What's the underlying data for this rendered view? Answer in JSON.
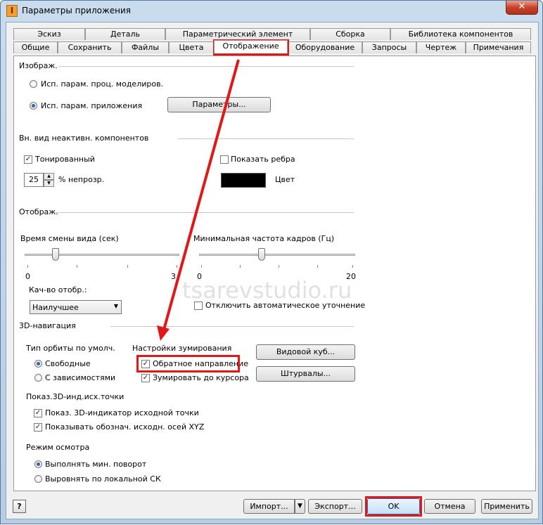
{
  "window": {
    "title": "Параметры приложения",
    "app_icon": "I",
    "close_glyph": "✕"
  },
  "tabs_row1": [
    "Эскиз",
    "Деталь",
    "Параметрический элемент",
    "Сборка",
    "Библиотека компонентов"
  ],
  "tabs_row2": [
    "Общие",
    "Сохранить",
    "Файлы",
    "Цвета",
    "Отображение",
    "Оборудование",
    "Запросы",
    "Чертеж",
    "Примечания"
  ],
  "section_image": {
    "title": "Изображ.",
    "radio_model": "Исп. парам. проц. моделиров.",
    "radio_app": "Исп. парам. приложения",
    "params_button": "Параметры..."
  },
  "section_inactive": {
    "title": "Вн. вид неактивн. компонентов",
    "shaded": "Тонированный",
    "show_edges": "Показать ребра",
    "opacity_value": "25",
    "opacity_label": "% непрозр.",
    "color_label": "Цвет",
    "color_swatch": "#000000"
  },
  "section_display": {
    "title": "Отображ.",
    "view_time_label": "Время смены вида (сек)",
    "view_time_min": "0",
    "view_time_max": "3",
    "view_time_level": 0.2,
    "frame_rate_label": "Минимальная частота кадров (Гц)",
    "frame_rate_min": "0",
    "frame_rate_max": "20",
    "frame_rate_level": 0.4,
    "quality_label": "Кач-во отобр.:",
    "quality_value": "Наилучшее",
    "disable_refine": "Отключить автоматическое уточнение"
  },
  "section_nav": {
    "title": "3D-навигация",
    "orbit_label": "Тип орбиты по умолч.",
    "orbit_free": "Свободные",
    "orbit_constrained": "С зависимостями",
    "zoom_label": "Настройки зумирования",
    "zoom_reverse": "Обратное направление",
    "zoom_cursor": "Зумировать до курсора",
    "viewcube_button": "Видовой куб...",
    "wheels_button": "Штурвалы...",
    "origin_label": "Показ.3D-инд.исх.точки",
    "origin_show": "Показ. 3D-индикатор исходной точки",
    "origin_axes": "Показывать обознач. исходн. осей XYZ",
    "view_mode_label": "Режим осмотра",
    "view_min_rotate": "Выполнять мин. поворот",
    "view_local_cs": "Выровнять по локальной СК"
  },
  "footer": {
    "help_icon": "?",
    "import_button": "Импорт...",
    "export_button": "Экспорт...",
    "ok_button": "OK",
    "cancel_button": "Отмена",
    "apply_button": "Применить"
  },
  "watermark": "tsarevstudio.ru",
  "colors": {
    "highlight": "#e01818",
    "title_bar": "#c9dcee"
  }
}
